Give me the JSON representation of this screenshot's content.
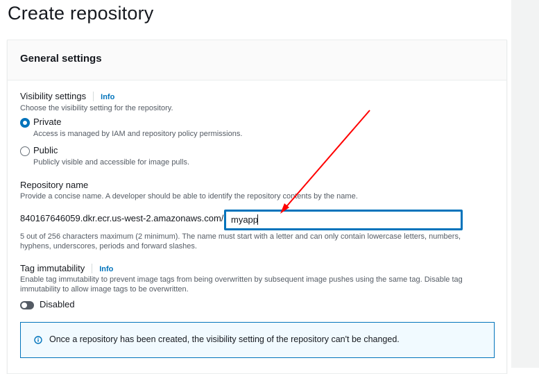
{
  "page": {
    "title": "Create repository"
  },
  "panel": {
    "title": "General settings"
  },
  "visibility": {
    "label": "Visibility settings",
    "info": "Info",
    "description": "Choose the visibility setting for the repository.",
    "options": [
      {
        "label": "Private",
        "description": "Access is managed by IAM and repository policy permissions.",
        "selected": true
      },
      {
        "label": "Public",
        "description": "Publicly visible and accessible for image pulls.",
        "selected": false
      }
    ]
  },
  "repository_name": {
    "label": "Repository name",
    "description": "Provide a concise name. A developer should be able to identify the repository contents by the name.",
    "prefix": "840167646059.dkr.ecr.us-west-2.amazonaws.com/",
    "value": "myapp",
    "constraint_line1": "5 out of 256 characters maximum (2 minimum). The name must start with a letter and can only contain lowercase letters, numbers,",
    "constraint_line2": "hyphens, underscores, periods and forward slashes."
  },
  "tag_immutability": {
    "label": "Tag immutability",
    "info": "Info",
    "description_line1": "Enable tag immutability to prevent image tags from being overwritten by subsequent image pushes using the same tag. Disable tag",
    "description_line2": "immutability to allow image tags to be overwritten.",
    "toggle_label": "Disabled",
    "enabled": false
  },
  "alert": {
    "icon": "info-icon",
    "text": "Once a repository has been created, the visibility setting of the repository can't be changed."
  },
  "colors": {
    "accent": "#0073bb",
    "annotation_arrow": "#ff0000",
    "toggle_off": "#545b64"
  }
}
